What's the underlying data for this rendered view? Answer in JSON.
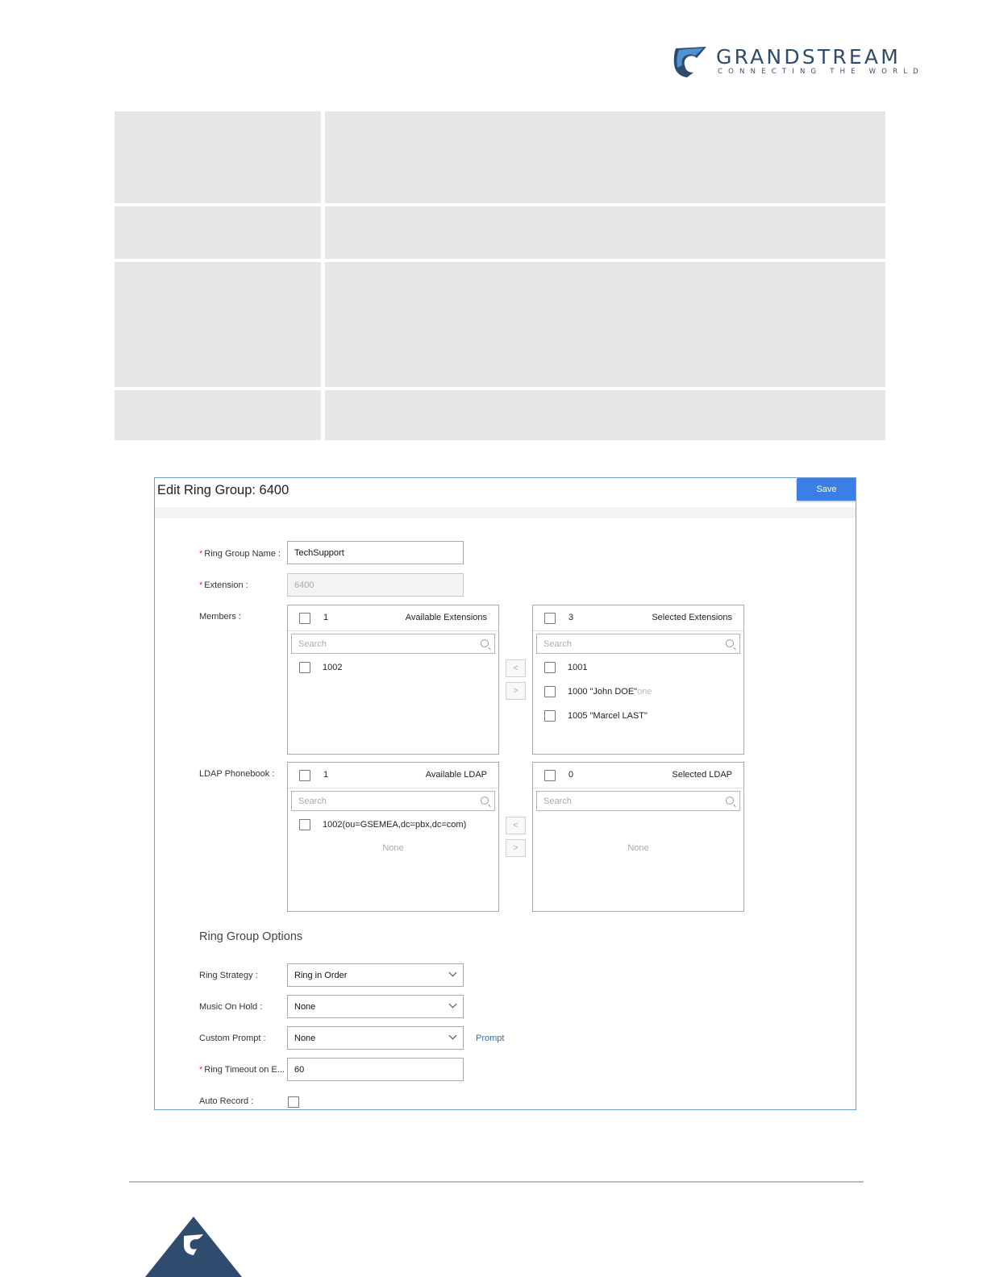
{
  "header": {
    "brand": "GRANDSTREAM",
    "tagline": "CONNECTING THE WORLD",
    "colors": {
      "brand": "#2f4b6e",
      "accent": "#3a7ee6"
    }
  },
  "dialog": {
    "title": "Edit Ring Group: 6400",
    "save_label": "Save",
    "fields": {
      "ring_group_name": {
        "label": "Ring Group Name",
        "value": "TechSupport",
        "required": true
      },
      "extension": {
        "label": "Extension",
        "value": "6400",
        "required": true
      },
      "members_label": "Members",
      "ldap_label": "LDAP Phonebook"
    },
    "members": {
      "available": {
        "count": "1",
        "title": "Available Extensions",
        "search_placeholder": "Search",
        "items": [
          "1002"
        ]
      },
      "selected": {
        "count": "3",
        "title": "Selected Extensions",
        "search_placeholder": "Search",
        "items": [
          "1001",
          "1000 \"John DOE\"",
          "1005 \"Marcel LAST\""
        ],
        "ghost_text": "one"
      }
    },
    "ldap": {
      "available": {
        "count": "1",
        "title": "Available LDAP",
        "search_placeholder": "Search",
        "items": [
          "1002(ou=GSEMEA,dc=pbx,dc=com)"
        ],
        "empty_text": "None"
      },
      "selected": {
        "count": "0",
        "title": "Selected LDAP",
        "search_placeholder": "Search",
        "empty_text": "None"
      }
    },
    "transfer_buttons": {
      "left": "<",
      "right": ">"
    },
    "options": {
      "section_title": "Ring Group Options",
      "ring_strategy": {
        "label": "Ring Strategy",
        "value": "Ring in Order"
      },
      "music_on_hold": {
        "label": "Music On Hold",
        "value": "None"
      },
      "custom_prompt": {
        "label": "Custom Prompt",
        "value": "None",
        "link": "Prompt"
      },
      "ring_timeout": {
        "label": "Ring Timeout on E...",
        "value": "60",
        "required": true
      },
      "auto_record": {
        "label": "Auto Record",
        "checked": false
      }
    }
  },
  "icons": {
    "logo": "grandstream-logo-icon",
    "search": "search-icon",
    "chevron": "chevron-down-icon",
    "footer": "grandstream-footer-logo-icon"
  }
}
